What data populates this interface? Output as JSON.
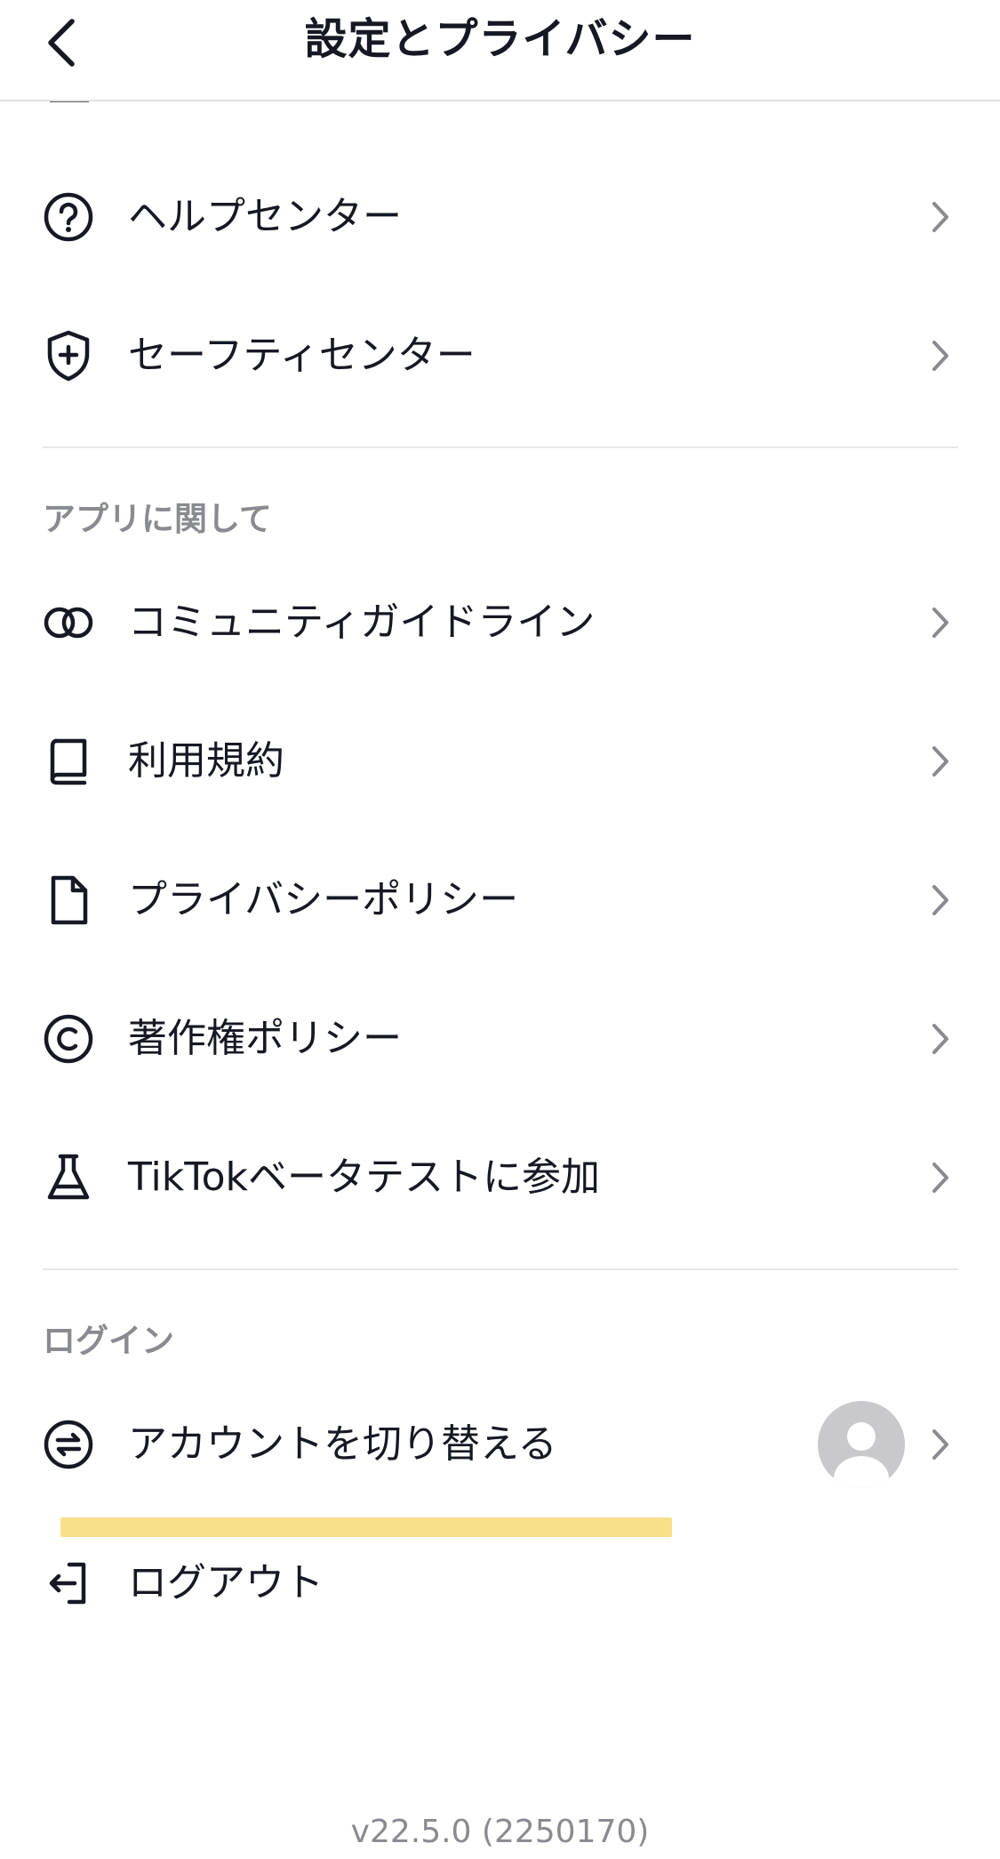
{
  "header": {
    "title": "設定とプライバシー",
    "back_icon": "chevron-left-icon"
  },
  "support_items": [
    {
      "label": "ヘルプセンター",
      "icon": "question-circle-icon"
    },
    {
      "label": "セーフティセンター",
      "icon": "shield-plus-icon"
    }
  ],
  "about_section": {
    "title": "アプリに関して",
    "items": [
      {
        "label": "コミュニティガイドライン",
        "icon": "overlapping-circles-icon"
      },
      {
        "label": "利用規約",
        "icon": "book-icon"
      },
      {
        "label": "プライバシーポリシー",
        "icon": "document-icon"
      },
      {
        "label": "著作権ポリシー",
        "icon": "copyright-icon"
      },
      {
        "label": "TikTokベータテストに参加",
        "icon": "flask-icon"
      }
    ]
  },
  "login_section": {
    "title": "ログイン",
    "switch_account": {
      "label": "アカウントを切り替える",
      "icon": "switch-arrows-icon"
    },
    "logout": {
      "label": "ログアウト",
      "icon": "logout-icon"
    }
  },
  "highlight_color": "#f8e08a",
  "version": "v22.5.0 (2250170)"
}
